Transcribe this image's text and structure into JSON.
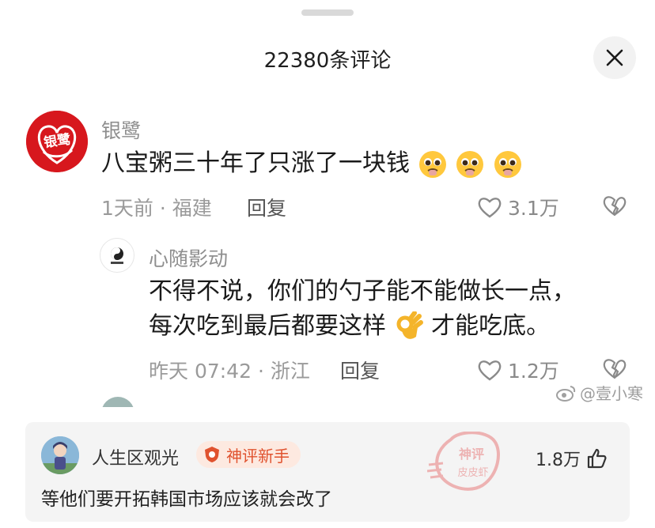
{
  "sheet": {
    "title": "22380条评论",
    "close_glyph": "✕"
  },
  "comments": [
    {
      "user": "银鹭",
      "avatar_text": "银鹭",
      "text": "八宝粥三十年了只涨了一块钱",
      "emojis": [
        "pleading-face",
        "pleading-face",
        "pleading-face"
      ],
      "meta": "1天前 · 福建",
      "reply_label": "回复",
      "likes": "3.1万"
    },
    {
      "user": "心随影动",
      "text_line1": "不得不说，你们的勺子能不能做长一点，",
      "text_line2_a": "每次吃到最后都要这样",
      "text_line2_b": "才能吃底。",
      "emoji": "ok-hand",
      "meta": "昨天 07:42 · 浙江",
      "reply_label": "回复",
      "likes": "1.2万"
    }
  ],
  "watermark": "@壹小寒",
  "featured_comment": {
    "user": "人生区观光",
    "badge": "神评新手",
    "likes": "1.8万",
    "text": "等他们要开拓韩国市场应该就会改了",
    "stamp_line1": "神评",
    "stamp_line2": "皮皮虾"
  },
  "colors": {
    "brand_red": "#d7171d",
    "badge_orange": "#e0522e",
    "meta_gray": "#9a9a9a"
  }
}
